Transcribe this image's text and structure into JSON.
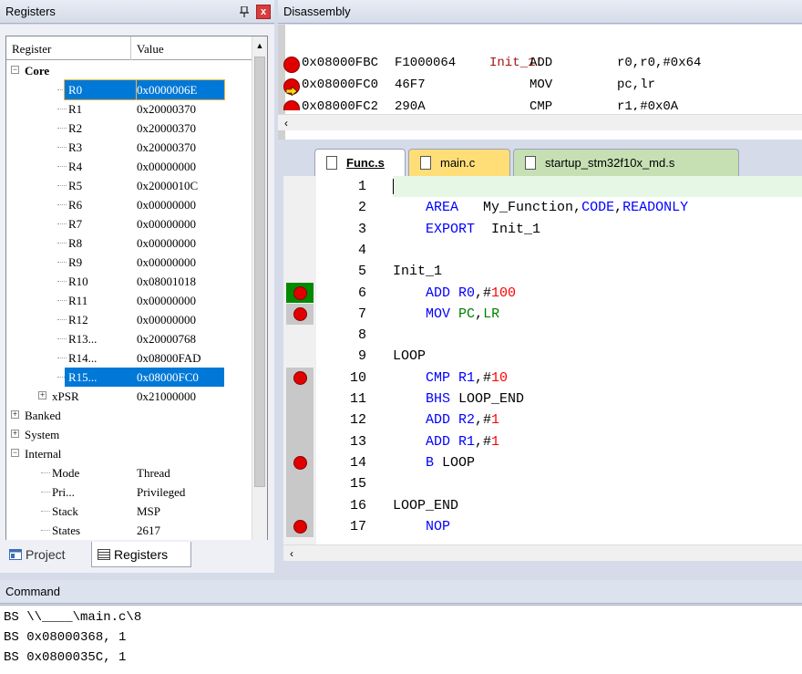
{
  "registers_panel": {
    "title": "Registers",
    "columns": [
      "Register",
      "Value"
    ],
    "groups": {
      "core": "Core",
      "banked": "Banked",
      "system": "System",
      "internal": "Internal"
    },
    "core_registers": [
      {
        "name": "R0",
        "value": "0x0000006E"
      },
      {
        "name": "R1",
        "value": "0x20000370"
      },
      {
        "name": "R2",
        "value": "0x20000370"
      },
      {
        "name": "R3",
        "value": "0x20000370"
      },
      {
        "name": "R4",
        "value": "0x00000000"
      },
      {
        "name": "R5",
        "value": "0x2000010C"
      },
      {
        "name": "R6",
        "value": "0x00000000"
      },
      {
        "name": "R7",
        "value": "0x00000000"
      },
      {
        "name": "R8",
        "value": "0x00000000"
      },
      {
        "name": "R9",
        "value": "0x00000000"
      },
      {
        "name": "R10",
        "value": "0x08001018"
      },
      {
        "name": "R11",
        "value": "0x00000000"
      },
      {
        "name": "R12",
        "value": "0x00000000"
      },
      {
        "name": "R13...",
        "value": "0x20000768"
      },
      {
        "name": "R14...",
        "value": "0x08000FAD"
      },
      {
        "name": "R15...",
        "value": "0x08000FC0"
      },
      {
        "name": "xPSR",
        "value": "0x21000000"
      }
    ],
    "internal_items": [
      {
        "name": "Mode",
        "value": "Thread"
      },
      {
        "name": "Pri...",
        "value": "Privileged"
      },
      {
        "name": "Stack",
        "value": "MSP"
      },
      {
        "name": "States",
        "value": "2617"
      }
    ],
    "tabs": [
      "Project",
      "Registers"
    ]
  },
  "disassembly_panel": {
    "title": "Disassembly",
    "label": "Init_1:",
    "rows": [
      {
        "addr": "0x08000FBC",
        "opcode": "F1000064",
        "mnemonic": "ADD",
        "operands": "r0,r0,#0x64"
      },
      {
        "addr": "0x08000FC0",
        "opcode": "46F7",
        "mnemonic": "MOV",
        "operands": "pc,lr"
      },
      {
        "addr": "0x08000FC2",
        "opcode": "290A",
        "mnemonic": "CMP",
        "operands": "r1,#0x0A"
      }
    ]
  },
  "editor_tabs": [
    "Func.s",
    "main.c",
    "startup_stm32f10x_md.s"
  ],
  "editor": {
    "lines": [
      {
        "n": "1",
        "segments": []
      },
      {
        "n": "2",
        "segments": [
          {
            "t": "    "
          },
          {
            "t": "AREA",
            "c": "kw"
          },
          {
            "t": "   My_Function,"
          },
          {
            "t": "CODE",
            "c": "kw"
          },
          {
            "t": ","
          },
          {
            "t": "READONLY",
            "c": "kw"
          }
        ]
      },
      {
        "n": "3",
        "segments": [
          {
            "t": "    "
          },
          {
            "t": "EXPORT",
            "c": "kw"
          },
          {
            "t": "  Init_1"
          }
        ]
      },
      {
        "n": "4",
        "segments": []
      },
      {
        "n": "5",
        "segments": [
          {
            "t": "Init_1"
          }
        ]
      },
      {
        "n": "6",
        "segments": [
          {
            "t": "    "
          },
          {
            "t": "ADD R0",
            "c": "kw"
          },
          {
            "t": ",#"
          },
          {
            "t": "100",
            "c": "num"
          }
        ]
      },
      {
        "n": "7",
        "segments": [
          {
            "t": "    "
          },
          {
            "t": "MOV",
            "c": "kw"
          },
          {
            "t": " "
          },
          {
            "t": "PC",
            "c": "reg"
          },
          {
            "t": ","
          },
          {
            "t": "LR",
            "c": "reg"
          }
        ]
      },
      {
        "n": "8",
        "segments": []
      },
      {
        "n": "9",
        "segments": [
          {
            "t": "LOOP"
          }
        ]
      },
      {
        "n": "10",
        "segments": [
          {
            "t": "    "
          },
          {
            "t": "CMP R1",
            "c": "kw"
          },
          {
            "t": ",#"
          },
          {
            "t": "10",
            "c": "num"
          }
        ]
      },
      {
        "n": "11",
        "segments": [
          {
            "t": "    "
          },
          {
            "t": "BHS",
            "c": "kw"
          },
          {
            "t": " LOOP_END"
          }
        ]
      },
      {
        "n": "12",
        "segments": [
          {
            "t": "    "
          },
          {
            "t": "ADD R2",
            "c": "kw"
          },
          {
            "t": ",#"
          },
          {
            "t": "1",
            "c": "num"
          }
        ]
      },
      {
        "n": "13",
        "segments": [
          {
            "t": "    "
          },
          {
            "t": "ADD R1",
            "c": "kw"
          },
          {
            "t": ",#"
          },
          {
            "t": "1",
            "c": "num"
          }
        ]
      },
      {
        "n": "14",
        "segments": [
          {
            "t": "    "
          },
          {
            "t": "B",
            "c": "kw"
          },
          {
            "t": " LOOP"
          }
        ]
      },
      {
        "n": "15",
        "segments": []
      },
      {
        "n": "16",
        "segments": [
          {
            "t": "LOOP_END"
          }
        ]
      },
      {
        "n": "17",
        "segments": [
          {
            "t": "    "
          },
          {
            "t": "NOP",
            "c": "kw"
          }
        ]
      }
    ]
  },
  "command_panel": {
    "title": "Command",
    "lines": [
      "BS \\\\____\\main.c\\8",
      "BS 0x08000368, 1",
      "BS 0x0800035C, 1"
    ]
  },
  "colors": {
    "selection": "#0078d7",
    "breakpoint": "#e00000",
    "keyword": "#0000ff",
    "number": "#ff0000",
    "register": "#008000",
    "tab_main": "#ffde78",
    "tab_startup": "#c6e0b4"
  }
}
